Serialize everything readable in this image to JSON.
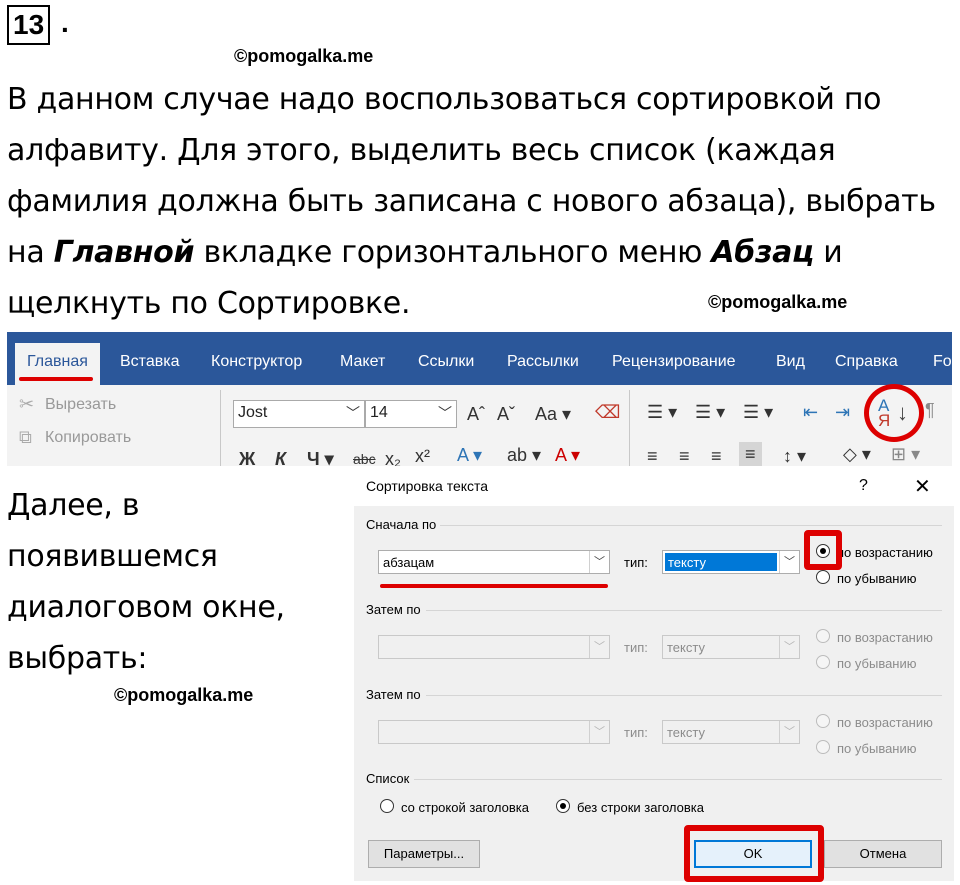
{
  "header": {
    "number": "13",
    "number_dot": "."
  },
  "watermarks": [
    "©pomogalka.me",
    "©pomogalka.me",
    "©pomogalka.me"
  ],
  "text": {
    "p1_line1": "В данном случае надо воспользоваться сортировкой по",
    "p1_line2": "алфавиту. Для этого, выделить весь список (каждая",
    "p1_line3": "фамилия должна быть записана с нового абзаца), выбрать",
    "p1_line4_a": "на ",
    "p1_line4_b": "Главной",
    "p1_line4_c": " вкладке горизонтального меню ",
    "p1_line4_d": "Абзац",
    "p1_line4_e": " и",
    "p1_line5": "щелкнуть по Сортировке.",
    "p2_line1": " Далее, в",
    "p2_line2": "появившемся",
    "p2_line3": "диалоговом окне,",
    "p2_line4": "выбрать:"
  },
  "ribbon": {
    "tabs": [
      "Главная",
      "Вставка",
      "Конструктор",
      "Макет",
      "Ссылки",
      "Рассылки",
      "Рецензирование",
      "Вид",
      "Справка",
      "Fo"
    ],
    "cut_label": "Вырезать",
    "copy_label": "Копировать",
    "font_name": "Jost",
    "font_size": "14",
    "accent_color": "#2b579a"
  },
  "dialog": {
    "title": "Сортировка текста",
    "help": "?",
    "close": "✕",
    "first_by_label": "Сначала по",
    "first_by_value": "абзацам",
    "type_label": "тип:",
    "type_value": "тексту",
    "ascending": "по возрастанию",
    "descending": "по убыванию",
    "then_by_label": "Затем по",
    "list_label": "Список",
    "with_header": "со строкой заголовка",
    "without_header": "без строки заголовка",
    "params_button": "Параметры...",
    "ok_button": "OK",
    "cancel_button": "Отмена"
  },
  "colors": {
    "highlight_red": "#dd0000",
    "selection_blue": "#0078d7"
  }
}
